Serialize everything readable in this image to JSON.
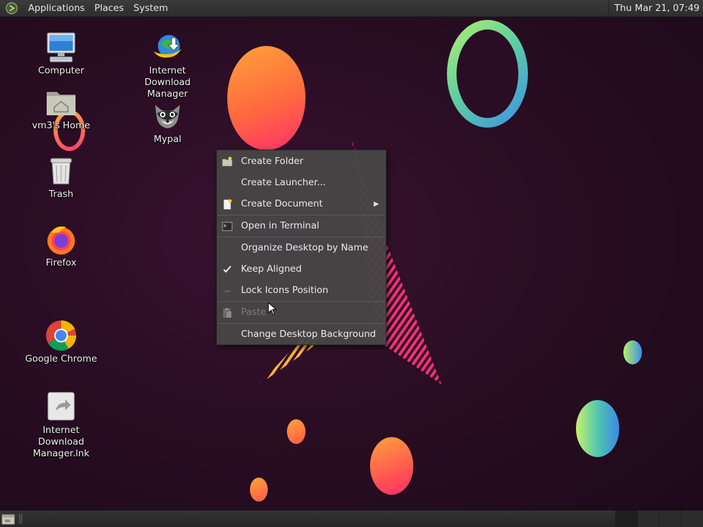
{
  "top_panel": {
    "menus": [
      "Applications",
      "Places",
      "System"
    ],
    "clock": "Thu Mar 21, 07:49"
  },
  "desktop_icons": {
    "computer": "Computer",
    "home": "vm3's Home",
    "trash": "Trash",
    "firefox": "Firefox",
    "chrome": "Google Chrome",
    "idm_lnk": "Internet Download Manager.lnk",
    "idm": "Internet Download Manager",
    "mypal": "Mypal"
  },
  "context_menu": {
    "create_folder": "Create Folder",
    "create_launcher": "Create Launcher...",
    "create_document": "Create Document",
    "open_terminal": "Open in Terminal",
    "organize": "Organize Desktop by Name",
    "keep_aligned": "Keep Aligned",
    "lock_icons": "Lock Icons Position",
    "paste": "Paste",
    "change_background": "Change Desktop Background"
  },
  "colors": {
    "panel": "#2f2f2f",
    "menu_bg": "#464646",
    "wallpaper": "#2a0d24",
    "disabled_text": "#7c7c7c"
  },
  "icons": [
    "mate-logo-icon",
    "computer-icon",
    "home-folder-icon",
    "trash-icon",
    "firefox-icon",
    "chrome-icon",
    "idm-shortcut-icon",
    "idm-icon",
    "mypal-icon",
    "folder-new-icon",
    "document-new-icon",
    "terminal-icon",
    "checkmark-icon",
    "lock-icon",
    "paste-icon",
    "submenu-arrow-icon",
    "mouse-cursor-icon",
    "show-desktop-icon"
  ]
}
